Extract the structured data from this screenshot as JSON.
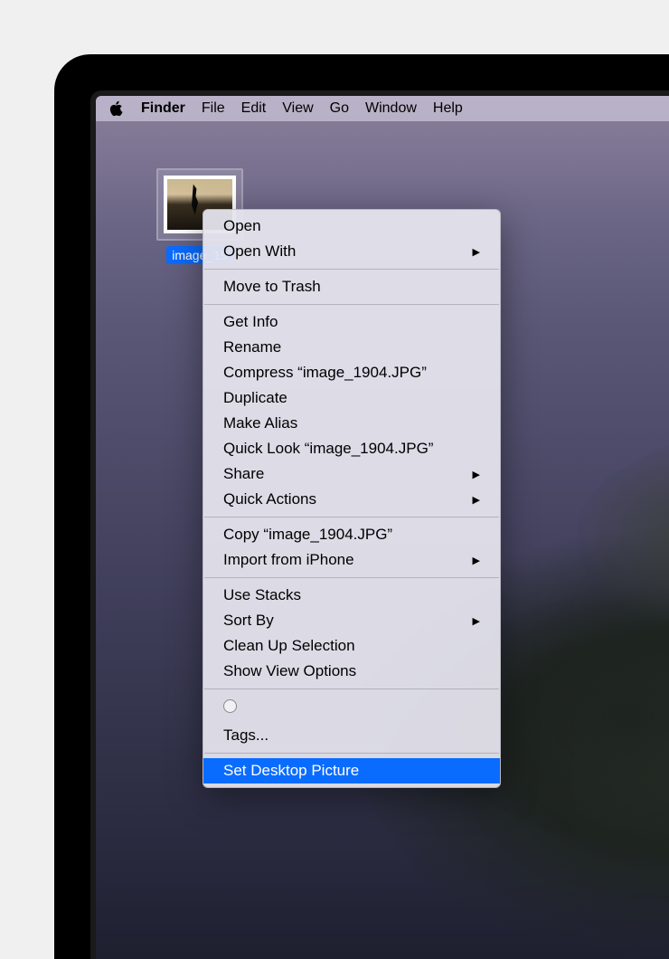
{
  "menubar": {
    "app": "Finder",
    "items": [
      "File",
      "Edit",
      "View",
      "Go",
      "Window",
      "Help"
    ]
  },
  "desktop_file": {
    "label": "image_19"
  },
  "context_menu": {
    "groups": [
      [
        {
          "label": "Open",
          "submenu": false
        },
        {
          "label": "Open With",
          "submenu": true
        }
      ],
      [
        {
          "label": "Move to Trash",
          "submenu": false
        }
      ],
      [
        {
          "label": "Get Info",
          "submenu": false
        },
        {
          "label": "Rename",
          "submenu": false
        },
        {
          "label": "Compress “image_1904.JPG”",
          "submenu": false
        },
        {
          "label": "Duplicate",
          "submenu": false
        },
        {
          "label": "Make Alias",
          "submenu": false
        },
        {
          "label": "Quick Look “image_1904.JPG”",
          "submenu": false
        },
        {
          "label": "Share",
          "submenu": true
        },
        {
          "label": "Quick Actions",
          "submenu": true
        }
      ],
      [
        {
          "label": "Copy “image_1904.JPG”",
          "submenu": false
        },
        {
          "label": "Import from iPhone",
          "submenu": true
        }
      ],
      [
        {
          "label": "Use Stacks",
          "submenu": false
        },
        {
          "label": "Sort By",
          "submenu": true
        },
        {
          "label": "Clean Up Selection",
          "submenu": false
        },
        {
          "label": "Show View Options",
          "submenu": false
        }
      ]
    ],
    "tags_label": "Tags...",
    "highlighted": "Set Desktop Picture"
  }
}
